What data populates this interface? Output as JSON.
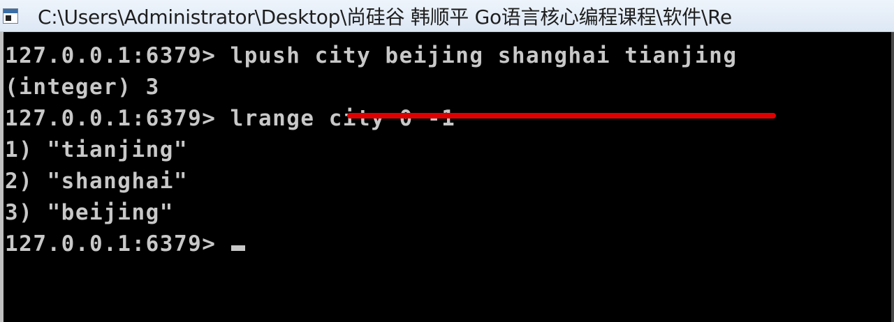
{
  "window": {
    "title": "C:\\Users\\Administrator\\Desktop\\尚硅谷 韩顺平 Go语言核心编程课程\\软件\\Re"
  },
  "console": {
    "lines": [
      "127.0.0.1:6379> lpush city beijing shanghai tianjing",
      "(integer) 3",
      "127.0.0.1:6379> lrange city 0 -1",
      "1) \"tianjing\"",
      "2) \"shanghai\"",
      "3) \"beijing\"",
      "127.0.0.1:6379>"
    ]
  },
  "colors": {
    "background": "#000000",
    "text": "#c8c8c8",
    "highlight_underline": "#e00000"
  }
}
